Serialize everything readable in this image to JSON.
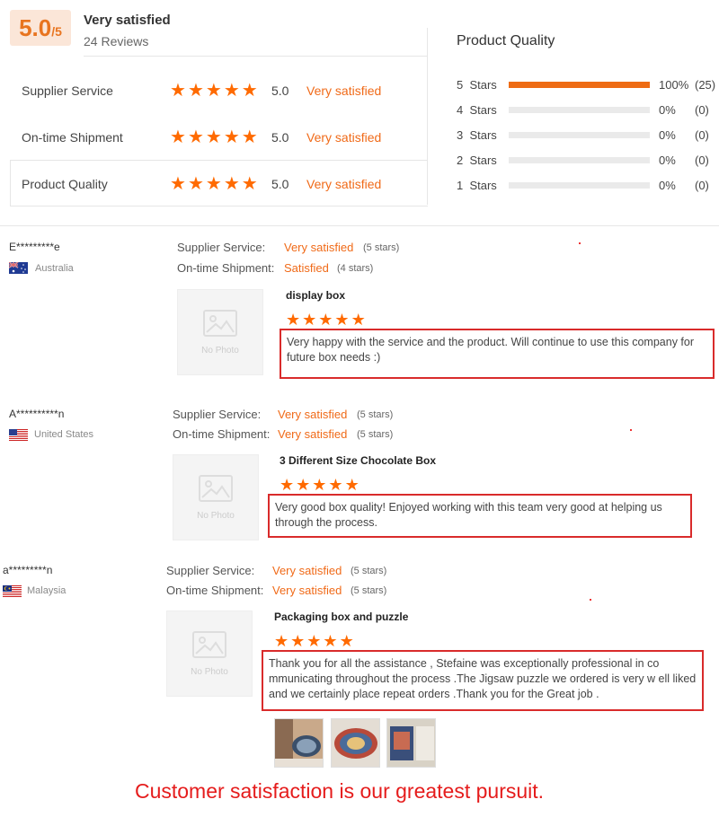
{
  "summary": {
    "score": "5.0",
    "score_suffix": "/5",
    "title": "Very satisfied",
    "reviews": "24 Reviews",
    "criteria": [
      {
        "label": "Supplier Service",
        "score": "5.0",
        "text": "Very satisfied",
        "stars": 5
      },
      {
        "label": "On-time Shipment",
        "score": "5.0",
        "text": "Very satisfied",
        "stars": 5
      },
      {
        "label": "Product Quality",
        "score": "5.0",
        "text": "Very satisfied",
        "stars": 5
      }
    ]
  },
  "quality": {
    "title": "Product Quality",
    "rows": [
      {
        "label": "5  Stars",
        "pct": "100%",
        "count": "(25)",
        "fill": 1.0
      },
      {
        "label": "4  Stars",
        "pct": "0%",
        "count": "(0)",
        "fill": 0
      },
      {
        "label": "3  Stars",
        "pct": "0%",
        "count": "(0)",
        "fill": 0
      },
      {
        "label": "2  Stars",
        "pct": "0%",
        "count": "(0)",
        "fill": 0
      },
      {
        "label": "1  Stars",
        "pct": "0%",
        "count": "(0)",
        "fill": 0
      }
    ]
  },
  "labels": {
    "supplier_service": "Supplier Service:",
    "ontime_shipment": "On-time Shipment:",
    "no_photo": "No Photo"
  },
  "reviews": [
    {
      "name": "E*********e",
      "country": "Australia",
      "supplier_text": "Very satisfied",
      "supplier_stars": "(5 stars)",
      "shipment_text": "Satisfied",
      "shipment_stars": "(4 stars)",
      "product": "display box",
      "rating": 5,
      "text": "Very happy with the service and the product. Will continue to use this company for future box needs :)"
    },
    {
      "name": "A**********n",
      "country": "United States",
      "supplier_text": "Very satisfied",
      "supplier_stars": "(5 stars)",
      "shipment_text": "Very satisfied",
      "shipment_stars": "(5 stars)",
      "product": "3 Different Size Chocolate Box",
      "rating": 5,
      "text": "Very good box quality! Enjoyed working with this team very good at helping us through the process."
    },
    {
      "name": "a*********n",
      "country": "Malaysia",
      "supplier_text": "Very satisfied",
      "supplier_stars": "(5 stars)",
      "shipment_text": "Very satisfied",
      "shipment_stars": "(5 stars)",
      "product": "Packaging box and puzzle",
      "rating": 5,
      "text": "Thank you for all the assistance , Stefaine was exceptionally professional in co mmunicating throughout the process .The Jigsaw puzzle we ordered is very w ell liked and we certainly place repeat orders .Thank you for the Great job ."
    }
  ],
  "tagline": "Customer satisfaction is our greatest pursuit.",
  "colors": {
    "accent": "#ff6a00",
    "box_border": "#d92b2b",
    "tagline": "#e51c1c"
  }
}
